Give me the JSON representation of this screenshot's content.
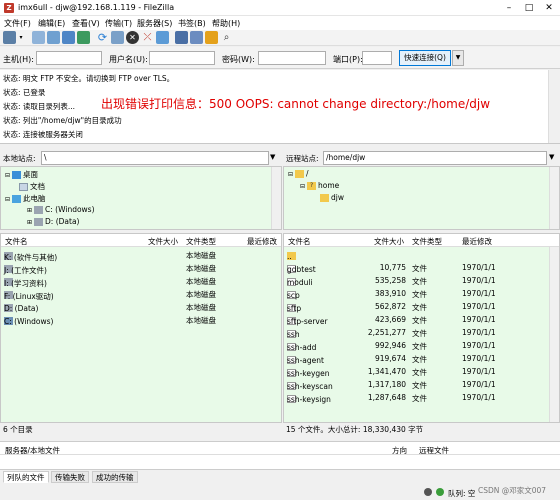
{
  "window": {
    "title": "imx6ull - djw@192.168.1.119 - FileZilla",
    "app_icon": "Z"
  },
  "menus": [
    "文件(F)",
    "编辑(E)",
    "查看(V)",
    "传输(T)",
    "服务器(S)",
    "书签(B)",
    "帮助(H)"
  ],
  "toolbar": {
    "icons": [
      "site-manager-icon",
      "dropdown-icon",
      "toggle-log-icon",
      "toggle-local-tree-icon",
      "toggle-remote-tree-icon",
      "toggle-queue-icon",
      "refresh-icon",
      "process-queue-icon",
      "cancel-icon",
      "disconnect-icon",
      "reconnect-icon",
      "filter-icon",
      "compare-icon",
      "sync-browse-icon",
      "search-icon"
    ]
  },
  "quickconnect": {
    "host_label": "主机(H):",
    "user_label": "用户名(U):",
    "pass_label": "密码(W):",
    "port_label": "端口(P):",
    "host_value": "",
    "user_value": "",
    "pass_value": "",
    "port_value": "",
    "button": "快速连接(Q)",
    "dropdown": "▼"
  },
  "log": [
    "状态: 明文 FTP 不安全。请切换到 FTP over TLS。",
    "状态: 已登录",
    "状态: 读取目录列表...",
    "状态: 列出\"/home/djw\"的目录成功",
    "状态: 连接被服务器关闭"
  ],
  "overlay_text": "出现错误打印信息：500 OOPS: cannot change directory:/home/djw",
  "local": {
    "site_label": "本地站点:",
    "path": "\\",
    "tree": [
      {
        "label": "桌面",
        "level": 1
      },
      {
        "label": "文档",
        "level": 2
      },
      {
        "label": "此电脑",
        "level": 1
      },
      {
        "label": "C: (Windows)",
        "level": 2
      },
      {
        "label": "D: (Data)",
        "level": 2
      }
    ],
    "columns": [
      "文件名",
      "文件大小",
      "文件类型",
      "最近修改"
    ],
    "files": [
      {
        "name": "K: (软件与其他)",
        "type": "本地磁盘"
      },
      {
        "name": "J: (工作文件)",
        "type": "本地磁盘"
      },
      {
        "name": "I: (学习资料)",
        "type": "本地磁盘"
      },
      {
        "name": "F: (Linux驱动)",
        "type": "本地磁盘"
      },
      {
        "name": "D: (Data)",
        "type": "本地磁盘"
      },
      {
        "name": "C: (Windows)",
        "type": "本地磁盘"
      }
    ],
    "status": "6 个目录"
  },
  "remote": {
    "site_label": "远程站点:",
    "path": "/home/djw",
    "tree": [
      {
        "label": "/",
        "level": 1
      },
      {
        "label": "home",
        "level": 2
      },
      {
        "label": "djw",
        "level": 3
      }
    ],
    "columns": [
      "文件名",
      "文件大小",
      "文件类型",
      "最近修改"
    ],
    "files": [
      {
        "name": "..",
        "size": "",
        "type": "",
        "modified": ""
      },
      {
        "name": "gdbtest",
        "size": "10,775",
        "type": "文件",
        "modified": "1970/1/1"
      },
      {
        "name": "moduli",
        "size": "535,258",
        "type": "文件",
        "modified": "1970/1/1"
      },
      {
        "name": "scp",
        "size": "383,910",
        "type": "文件",
        "modified": "1970/1/1"
      },
      {
        "name": "sftp",
        "size": "562,872",
        "type": "文件",
        "modified": "1970/1/1"
      },
      {
        "name": "sftp-server",
        "size": "423,669",
        "type": "文件",
        "modified": "1970/1/1"
      },
      {
        "name": "ssh",
        "size": "2,251,277",
        "type": "文件",
        "modified": "1970/1/1"
      },
      {
        "name": "ssh-add",
        "size": "992,946",
        "type": "文件",
        "modified": "1970/1/1"
      },
      {
        "name": "ssh-agent",
        "size": "919,674",
        "type": "文件",
        "modified": "1970/1/1"
      },
      {
        "name": "ssh-keygen",
        "size": "1,341,470",
        "type": "文件",
        "modified": "1970/1/1"
      },
      {
        "name": "ssh-keyscan",
        "size": "1,317,180",
        "type": "文件",
        "modified": "1970/1/1"
      },
      {
        "name": "ssh-keysign",
        "size": "1,287,648",
        "type": "文件",
        "modified": "1970/1/1"
      }
    ],
    "status": "15 个文件。大小总计: 18,330,430 字节"
  },
  "queue": {
    "col_server": "服务器/本地文件",
    "col_direction": "方向",
    "col_remote": "远程文件"
  },
  "tabs": [
    "列队的文件",
    "传输失败",
    "成功的传输"
  ],
  "bottom": {
    "queue_label": "队列: 空",
    "watermark": "CSDN @邓家文007"
  },
  "colors": {
    "panel_bg": "#e8fae8",
    "overlay_red": "#e00000",
    "folder_yellow": "#f2c94c",
    "drive_gray": "#9aa4b1",
    "quickconnect_border": "#0078d7"
  }
}
